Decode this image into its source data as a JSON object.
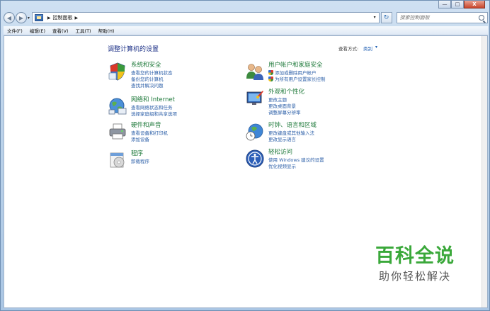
{
  "window": {
    "caption_buttons": [
      "—",
      "□",
      "X"
    ]
  },
  "address_bar": {
    "location": "控制面板",
    "search_placeholder": "搜索控制面板"
  },
  "menu": [
    "文件(F)",
    "编辑(E)",
    "查看(V)",
    "工具(T)",
    "帮助(H)"
  ],
  "page": {
    "title": "调整计算机的设置",
    "view_by_label": "查看方式:",
    "view_by_value": "类别"
  },
  "categories_left": [
    {
      "title": "系统和安全",
      "icon": "shield-icon",
      "links": [
        "查看您的计算机状态",
        "备份您的计算机",
        "查找并解决问题"
      ]
    },
    {
      "title": "网络和 Internet",
      "icon": "network-globe-icon",
      "links": [
        "查看网络状态和任务",
        "选择家庭组和共享选项"
      ]
    },
    {
      "title": "硬件和声音",
      "icon": "printer-icon",
      "links": [
        "查看设备和打印机",
        "添加设备"
      ]
    },
    {
      "title": "程序",
      "icon": "programs-icon",
      "links": [
        "卸载程序"
      ]
    }
  ],
  "categories_right": [
    {
      "title": "用户帐户和家庭安全",
      "icon": "users-icon",
      "links": [
        "添加或删除用户帐户",
        "为所有用户设置家长控制"
      ]
    },
    {
      "title": "外观和个性化",
      "icon": "appearance-icon",
      "links": [
        "更改主题",
        "更改桌面背景",
        "调整屏幕分辨率"
      ]
    },
    {
      "title": "时钟、语言和区域",
      "icon": "clock-globe-icon",
      "links": [
        "更改键盘或其他输入法",
        "更改显示语言"
      ]
    },
    {
      "title": "轻松访问",
      "icon": "accessibility-icon",
      "links": [
        "使用 Windows 建议的设置",
        "优化视频显示"
      ]
    }
  ],
  "watermark": {
    "big": "百科全说",
    "small": "助你轻松解决"
  },
  "colors": {
    "category_title": "#1f7a3b",
    "link": "#2c5fa8",
    "page_title": "#1e3287",
    "watermark_green": "#3aa83a"
  }
}
